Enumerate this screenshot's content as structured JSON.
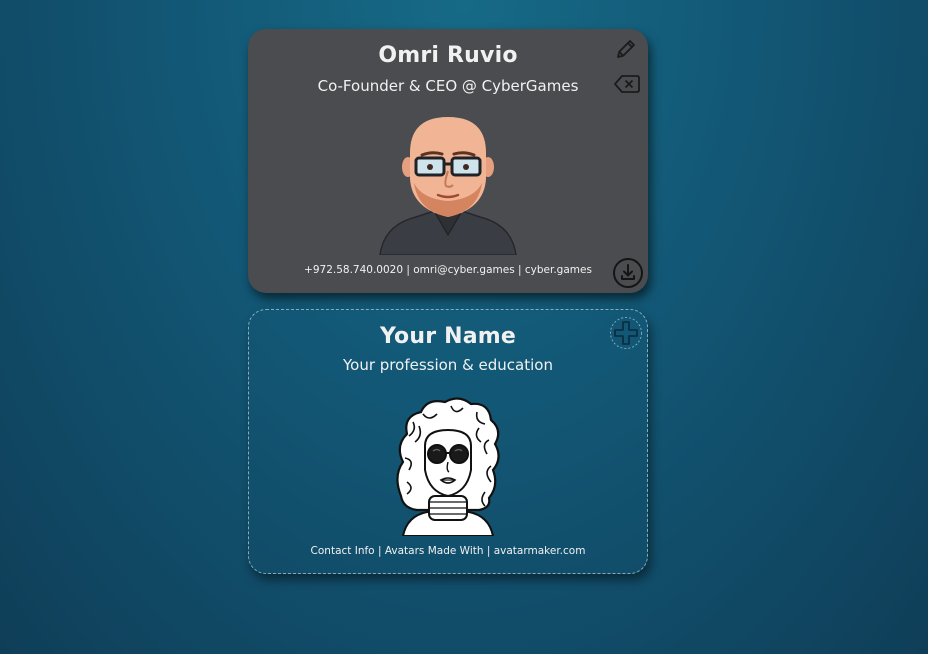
{
  "card": {
    "name": "Omri Ruvio",
    "title": "Co-Founder & CEO @ CyberGames",
    "contact": "+972.58.740.0020 | omri@cyber.games | cyber.games",
    "icons": [
      "pencil-icon",
      "backspace-icon",
      "download-icon"
    ]
  },
  "template": {
    "name": "Your Name",
    "title": "Your profession & education",
    "contact": "Contact Info | Avatars Made With | avatarmaker.com",
    "icons": [
      "plus-icon"
    ]
  },
  "colors": {
    "background": "#125775",
    "card_bg": "#4a4c4f",
    "text": "#f1f1f1"
  }
}
